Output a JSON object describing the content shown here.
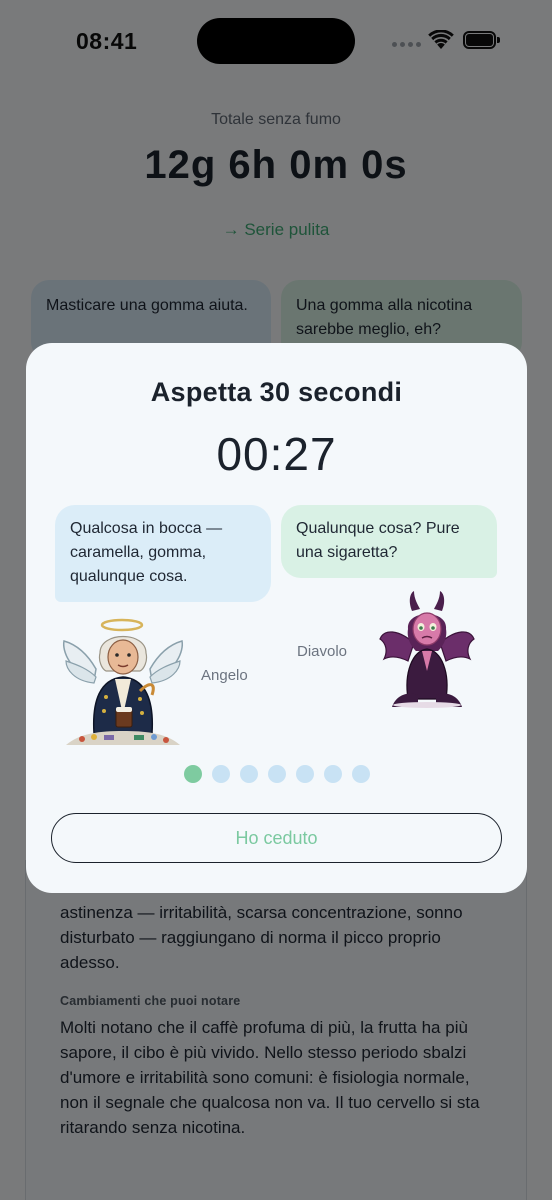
{
  "status_bar": {
    "time": "08:41"
  },
  "summary": {
    "total_label": "Totale senza fumo",
    "total_value": "12g 6h 0m 0s",
    "streak_link": "→ Serie pulita"
  },
  "background_cards": {
    "left": "Masticare una gomma aiuta.",
    "right": "Una gomma alla nicotina sarebbe meglio, eh?"
  },
  "article": {
    "paragraph_1": "astinenza — irritabilità, scarsa concentrazione, sonno disturbato — raggiungano di norma il picco proprio adesso.",
    "heading_2": "Cambiamenti che puoi notare",
    "paragraph_2": "Molti notano che il caffè profuma di più, la frutta ha più sapore, il cibo è più vivido. Nello stesso periodo sbalzi d'umore e irritabilità sono comuni: è fisiologia normale, non il segnale che qualcosa non va. Il tuo cervello si sta ritarando senza nicotina."
  },
  "modal": {
    "title": "Aspetta 30 secondi",
    "countdown": "00:27",
    "angel_bubble": "Qualcosa in bocca — caramella, gomma, qualunque cosa.",
    "devil_bubble": "Qualunque cosa? Pure una sigaretta?",
    "angel_name": "Angelo",
    "devil_name": "Diavolo",
    "pager": {
      "total": 7,
      "active": 0
    },
    "give_up_label": "Ho ceduto"
  },
  "colors": {
    "accent_green": "#3fa874",
    "dot_active": "#7ecba0",
    "dot_inactive": "#c8e2f4",
    "angel_bubble": "#dbedf8",
    "devil_bubble": "#d9f1e5"
  },
  "icons": [
    "signal-icon",
    "wifi-icon",
    "battery-icon"
  ]
}
